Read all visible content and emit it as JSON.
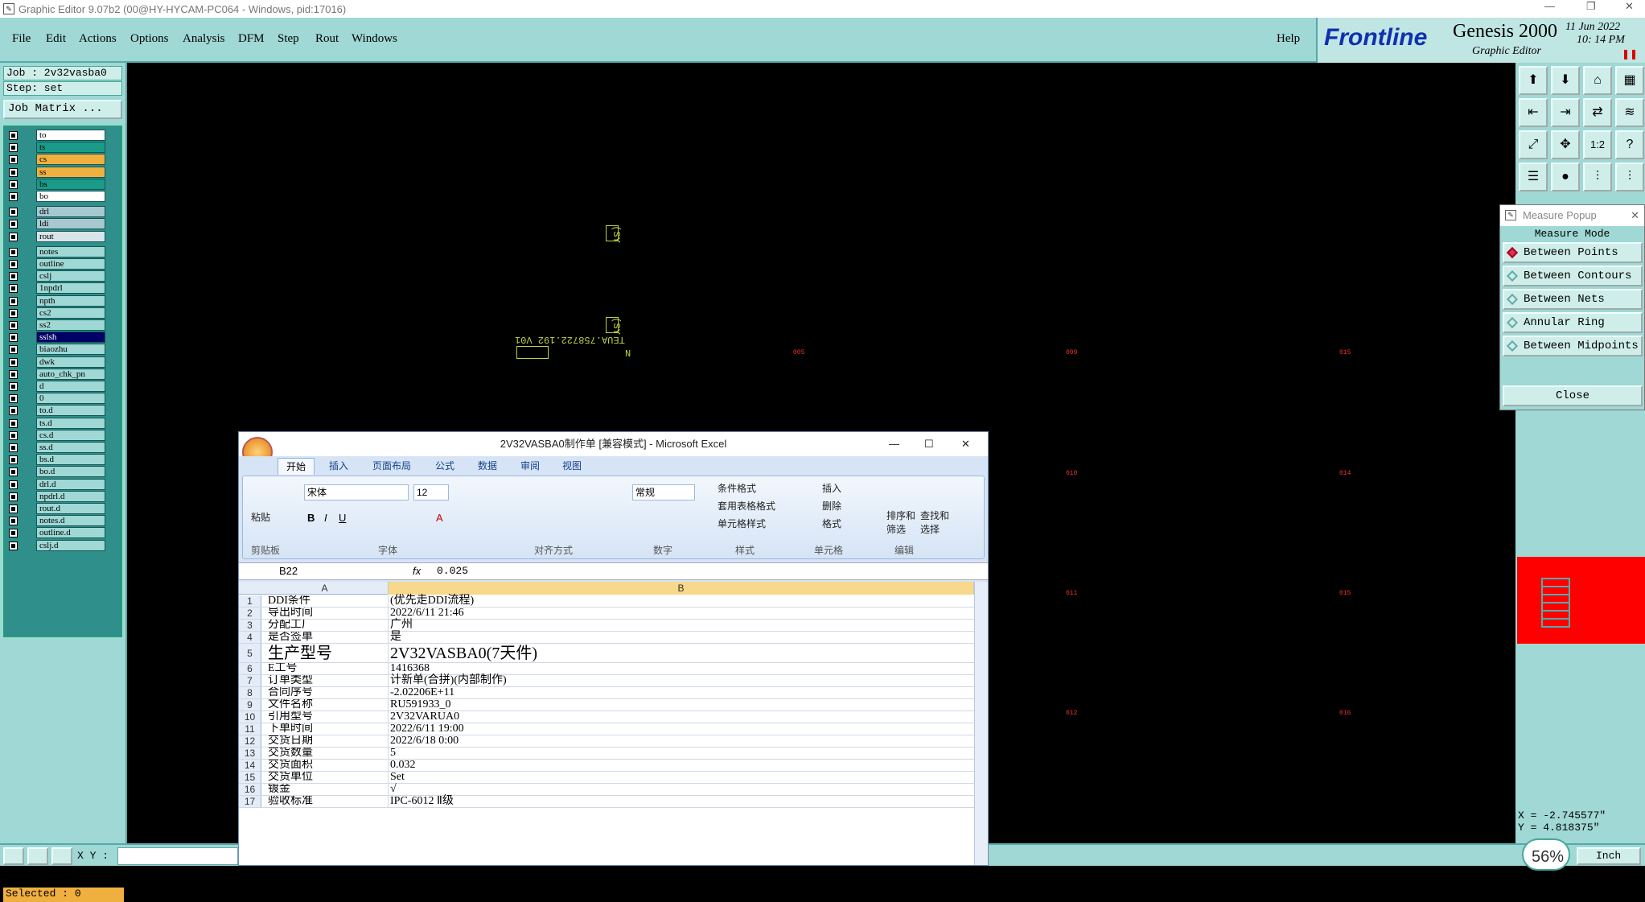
{
  "window": {
    "title": "Graphic Editor 9.07b2 (00@HY-HYCAM-PC064 - Windows, pid:17016)"
  },
  "menu": {
    "file": "File",
    "edit": "Edit",
    "actions": "Actions",
    "options": "Options",
    "analysis": "Analysis",
    "dfm": "DFM",
    "step": "Step",
    "rout": "Rout",
    "windows": "Windows",
    "help": "Help"
  },
  "brand": {
    "logo": "Frontline",
    "product": "Genesis 2000",
    "subtitle": "Graphic Editor",
    "date": "11 Jun 2022",
    "time": "10: 14 PM"
  },
  "left": {
    "job": "Job : 2v32vasba0",
    "step": "Step: set",
    "job_matrix": "Job Matrix ...",
    "selected": "Selected : 0",
    "layers": [
      {
        "name": "to",
        "color": "#ffffff"
      },
      {
        "name": "ts",
        "color": "#1a9b8a"
      },
      {
        "name": "cs",
        "color": "#f0b040"
      },
      {
        "name": "ss",
        "color": "#f0b040"
      },
      {
        "name": "bs",
        "color": "#1a9b8a"
      },
      {
        "name": "bo",
        "color": "#ffffff"
      },
      {
        "name": "drl",
        "color": "#a8c8d0"
      },
      {
        "name": "ldi",
        "color": "#a8c8d0"
      },
      {
        "name": "rout",
        "color": "#d8e4e8"
      },
      {
        "name": "notes",
        "color": "#9fd8d4"
      },
      {
        "name": "outline",
        "color": "#9fd8d4"
      },
      {
        "name": "cslj",
        "color": "#9fd8d4"
      },
      {
        "name": "1npdrl",
        "color": "#9fd8d4"
      },
      {
        "name": "npth",
        "color": "#9fd8d4"
      },
      {
        "name": "cs2",
        "color": "#9fd8d4"
      },
      {
        "name": "ss2",
        "color": "#9fd8d4"
      },
      {
        "name": "sslsh",
        "color": "#000066"
      },
      {
        "name": "biaozhu",
        "color": "#9fd8d4"
      },
      {
        "name": "dwk",
        "color": "#9fd8d4"
      },
      {
        "name": "auto_chk_pn",
        "color": "#9fd8d4"
      },
      {
        "name": "d",
        "color": "#9fd8d4"
      },
      {
        "name": "0",
        "color": "#9fd8d4"
      },
      {
        "name": "to.d",
        "color": "#9fd8d4"
      },
      {
        "name": "ts.d",
        "color": "#9fd8d4"
      },
      {
        "name": "cs.d",
        "color": "#9fd8d4"
      },
      {
        "name": "ss.d",
        "color": "#9fd8d4"
      },
      {
        "name": "bs.d",
        "color": "#9fd8d4"
      },
      {
        "name": "bo.d",
        "color": "#9fd8d4"
      },
      {
        "name": "drl.d",
        "color": "#9fd8d4"
      },
      {
        "name": "npdrl.d",
        "color": "#9fd8d4"
      },
      {
        "name": "rout.d",
        "color": "#9fd8d4"
      },
      {
        "name": "notes.d",
        "color": "#9fd8d4"
      },
      {
        "name": "outline.d",
        "color": "#9fd8d4"
      },
      {
        "name": "cslj.d",
        "color": "#9fd8d4"
      }
    ]
  },
  "canvas": {
    "label1": "TEUA.758722.192 V01",
    "label2": "N",
    "label3": "(SY",
    "label4": "(SY"
  },
  "bottom": {
    "xy_label": "X Y :",
    "zoom": "56%",
    "unit": "Inch"
  },
  "coords": {
    "x": "X = -2.745577\"",
    "y": "Y = 4.818375\""
  },
  "measure": {
    "title": "Measure Popup",
    "mode": "Measure Mode",
    "options": [
      "Between Points",
      "Between Contours",
      "Between Nets",
      "Annular Ring",
      "Between Midpoints"
    ],
    "selected": "Between Points",
    "close": "Close"
  },
  "excel": {
    "title": "2V32VASBA0制作单 [兼容模式] - Microsoft Excel",
    "tabs": [
      "开始",
      "插入",
      "页面布局",
      "公式",
      "数据",
      "审阅",
      "视图"
    ],
    "groups": [
      "剪贴板",
      "字体",
      "对齐方式",
      "数字",
      "样式",
      "单元格",
      "编辑"
    ],
    "font": "宋体",
    "size": "12",
    "numfmt": "常规",
    "paste": "粘贴",
    "cond_fmt": "条件格式",
    "table_fmt": "套用表格格式",
    "cell_style": "单元格样式",
    "insert": "插入",
    "delete": "删除",
    "format": "格式",
    "sort": "排序和筛选",
    "find": "查找和选择",
    "cell_ref": "B22",
    "formula": "0.025",
    "fx": "fx",
    "col_a": "A",
    "col_b": "B",
    "rows": [
      [
        "1",
        "DDI条件",
        "(优先走DDI流程)"
      ],
      [
        "2",
        "导出时间",
        "2022/6/11 21:46"
      ],
      [
        "3",
        "分配工厂",
        "广州"
      ],
      [
        "4",
        "是否签单",
        "是"
      ],
      [
        "5",
        "生产型号",
        "2V32VASBA0(7天件)"
      ],
      [
        "6",
        "E工号",
        "1416368"
      ],
      [
        "7",
        "订单类型",
        "计新单(合拼)(内部制作)"
      ],
      [
        "8",
        "合同序号",
        "-2.02206E+11"
      ],
      [
        "9",
        "文件名称",
        "RU591933_0"
      ],
      [
        "10",
        "引用型号",
        "2V32VARUA0"
      ],
      [
        "11",
        "下单时间",
        "2022/6/11 19:00"
      ],
      [
        "12",
        "交货日期",
        "2022/6/18 0:00"
      ],
      [
        "13",
        "交货数量",
        "5"
      ],
      [
        "14",
        "交货面积",
        "0.032"
      ],
      [
        "15",
        "交货单位",
        "Set"
      ],
      [
        "16",
        "镀金",
        "√"
      ],
      [
        "17",
        "验收标准",
        "IPC-6012 Ⅱ级"
      ]
    ]
  }
}
